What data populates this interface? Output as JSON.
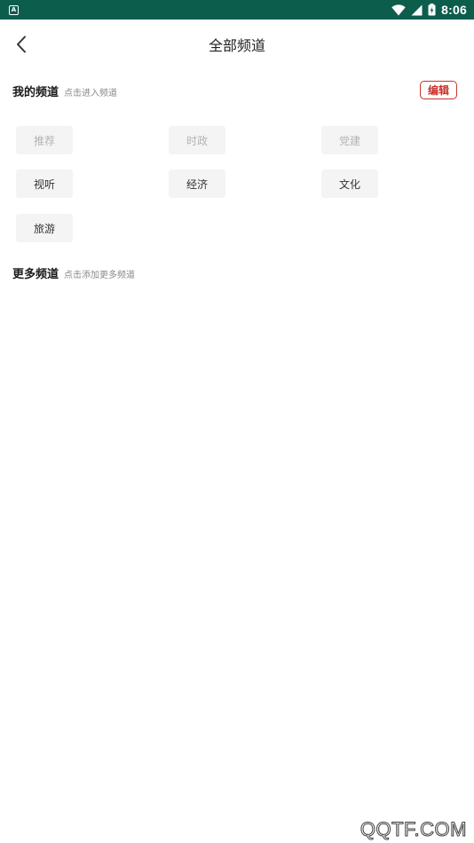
{
  "status_bar": {
    "notification_icon_letter": "A",
    "time": "8:06",
    "icons": [
      "wifi-icon",
      "signal-icon",
      "battery-icon"
    ],
    "background_color": "#0d5d4d"
  },
  "header": {
    "title": "全部频道",
    "back_icon": "chevron-left-icon"
  },
  "my_channels": {
    "title": "我的频道",
    "hint": "点击进入频道",
    "edit_label": "编辑",
    "items": [
      {
        "label": "推荐",
        "fixed": true
      },
      {
        "label": "时政",
        "fixed": true
      },
      {
        "label": "党建",
        "fixed": true
      },
      {
        "label": "视听",
        "fixed": false
      },
      {
        "label": "经济",
        "fixed": false
      },
      {
        "label": "文化",
        "fixed": false
      },
      {
        "label": "旅游",
        "fixed": false
      }
    ]
  },
  "more_channels": {
    "title": "更多频道",
    "hint": "点击添加更多频道"
  },
  "watermark": "QQTF.COM",
  "colors": {
    "accent": "#c8322a",
    "chip_bg": "#f4f4f4",
    "fixed_text": "#b3b3b3"
  }
}
